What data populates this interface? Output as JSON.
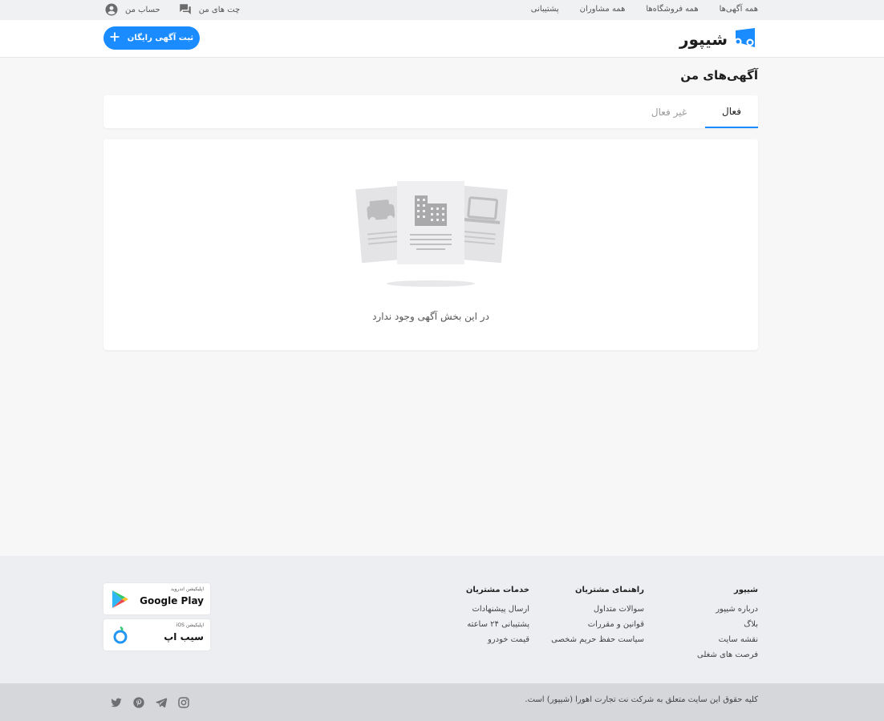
{
  "topbar": {
    "links": [
      "همه آگهی‌ها",
      "همه فروشگاه‌ها",
      "همه مشاوران",
      "پشتیبانی"
    ],
    "account_label": "حساب من",
    "chats_label": "چت های من"
  },
  "header": {
    "logo_text": "شیپور",
    "cta_label": "ثبت آگهی رایگان"
  },
  "page": {
    "title": "آگهی‌های من",
    "tabs": [
      {
        "label": "فعال",
        "active": true
      },
      {
        "label": "غیر فعال",
        "active": false
      }
    ],
    "empty_message": "در این بخش آگهی وجود ندارد"
  },
  "footer": {
    "columns": [
      {
        "title": "شیپور",
        "links": [
          "درباره شیپور",
          "بلاگ",
          "نقشه سایت",
          "فرصت های شغلی"
        ]
      },
      {
        "title": "راهنمای مشتریان",
        "links": [
          "سوالات متداول",
          "قوانین و مقررات",
          "سیاست حفظ حریم شخصی"
        ]
      },
      {
        "title": "خدمات مشتریان",
        "links": [
          "ارسال پیشنهادات",
          "پشتیبانی ۲۴ ساعته",
          "قیمت خودرو"
        ]
      }
    ],
    "apps": {
      "google_play_sub": "اپلیکیشن اندروید",
      "google_play_name": "Google Play",
      "ios_sub": "اپلیکیشن iOS",
      "ios_name": "سیب اپ"
    },
    "copyright": "کلیه حقوق این سایت متعلق به شرکت نت تجارت اهورا (شیپور) است.",
    "social_icons": [
      "instagram-icon",
      "telegram-icon",
      "pinterest-icon",
      "twitter-icon"
    ]
  },
  "colors": {
    "accent": "#1a8cff",
    "page_bg": "#f7f7f8",
    "footer_bg": "#eceef1",
    "copyright_bg": "#d5d7da"
  }
}
